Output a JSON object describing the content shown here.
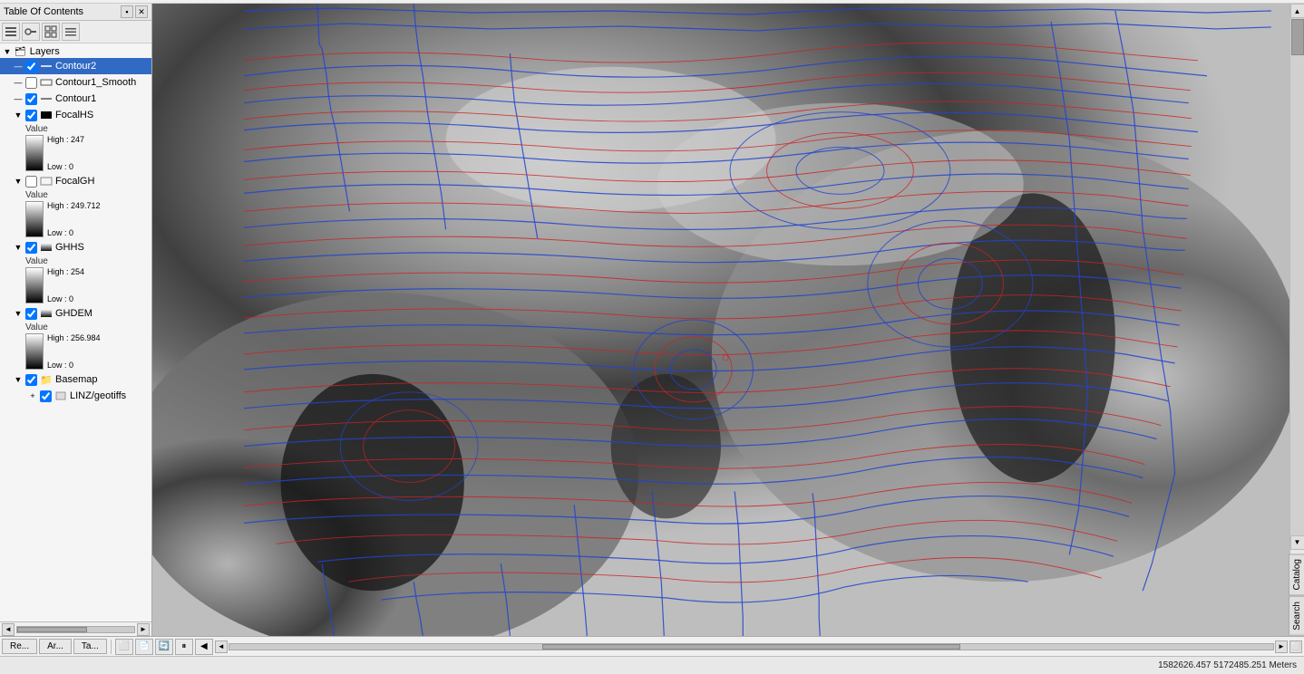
{
  "toc": {
    "title": "Table Of Contents",
    "pin_btn": "▪",
    "close_btn": "✕",
    "toolbar_icons": [
      "list-icon",
      "layer-icon",
      "folder-icon",
      "options-icon"
    ],
    "layers_group": "Layers",
    "layers": [
      {
        "id": "contour2",
        "name": "Contour2",
        "checked": true,
        "selected": true,
        "icon": "line-icon",
        "has_legend": false
      },
      {
        "id": "contour1smooth",
        "name": "Contour1_Smooth",
        "checked": false,
        "selected": false,
        "icon": "square-icon",
        "has_legend": false
      },
      {
        "id": "contour1",
        "name": "Contour1",
        "checked": true,
        "selected": false,
        "icon": "line-icon",
        "has_legend": false
      },
      {
        "id": "focalhs",
        "name": "FocalHS",
        "checked": true,
        "selected": false,
        "icon": "raster-icon",
        "has_legend": true,
        "legend": {
          "title": "Value",
          "high_label": "High : 247",
          "low_label": "Low : 0"
        }
      },
      {
        "id": "focalgh",
        "name": "FocalGH",
        "checked": false,
        "selected": false,
        "icon": "square-icon",
        "has_legend": true,
        "legend": {
          "title": "Value",
          "high_label": "High : 249.712",
          "low_label": "Low : 0"
        }
      },
      {
        "id": "ghhs",
        "name": "GHHS",
        "checked": true,
        "selected": false,
        "icon": "raster-icon",
        "has_legend": true,
        "legend": {
          "title": "Value",
          "high_label": "High : 254",
          "low_label": "Low : 0"
        }
      },
      {
        "id": "ghdem",
        "name": "GHDEM",
        "checked": true,
        "selected": false,
        "icon": "raster-icon",
        "has_legend": true,
        "legend": {
          "title": "Value",
          "high_label": "High : 256.984",
          "low_label": "Low : 0"
        }
      },
      {
        "id": "basemap",
        "name": "Basemap",
        "checked": true,
        "selected": false,
        "icon": "folder-icon",
        "has_legend": false,
        "sub_items": [
          {
            "id": "linz_geotiffs",
            "name": "LINZ/geotiffs",
            "checked": true,
            "selected": false
          }
        ]
      }
    ]
  },
  "right_tabs": [
    "Catalog",
    "Search"
  ],
  "bottom_tabs": [
    {
      "label": "Re...",
      "active": false
    },
    {
      "label": "Ar...",
      "active": false
    },
    {
      "label": "Ta...",
      "active": false
    }
  ],
  "bottom_toolbar_icons": [
    "toolbar1",
    "toolbar2",
    "toolbar3",
    "toolbar4",
    "toolbar5",
    "toolbar6"
  ],
  "status_bar": {
    "coords": "1582626.457  5172485.251 Meters"
  },
  "scrollbar": {
    "up_arrow": "▲",
    "down_arrow": "▼",
    "left_arrow": "◄",
    "right_arrow": "►"
  }
}
